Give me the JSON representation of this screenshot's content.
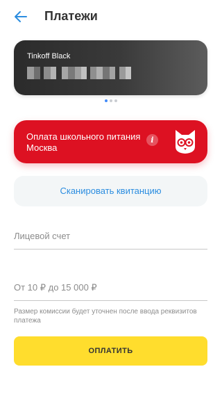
{
  "header": {
    "back_icon": "arrow-left-icon",
    "title": "Платежи",
    "accent_color": "#2b8de0"
  },
  "card": {
    "name": "Tinkoff Black",
    "number_state": "pixelated/hidden",
    "pager": {
      "total": 3,
      "active_index": 0
    }
  },
  "provider": {
    "line1": "Оплата школьного питания",
    "line2": "Москва",
    "info_icon": "info-icon",
    "info_glyph": "i",
    "logo_icon": "owl-logo-icon",
    "color": "#dd1122"
  },
  "scan_button": {
    "label": "Сканировать квитанцию"
  },
  "account_field": {
    "placeholder": "Лицевой счет",
    "value": ""
  },
  "amount_field": {
    "placeholder": "От 10 ₽ до 15 000 ₽",
    "value": ""
  },
  "hint": "Размер комиссии будет уточнен после ввода реквизитов платежа",
  "pay_button": {
    "label": "ОПЛАТИТЬ",
    "color": "#ffdd2d"
  }
}
